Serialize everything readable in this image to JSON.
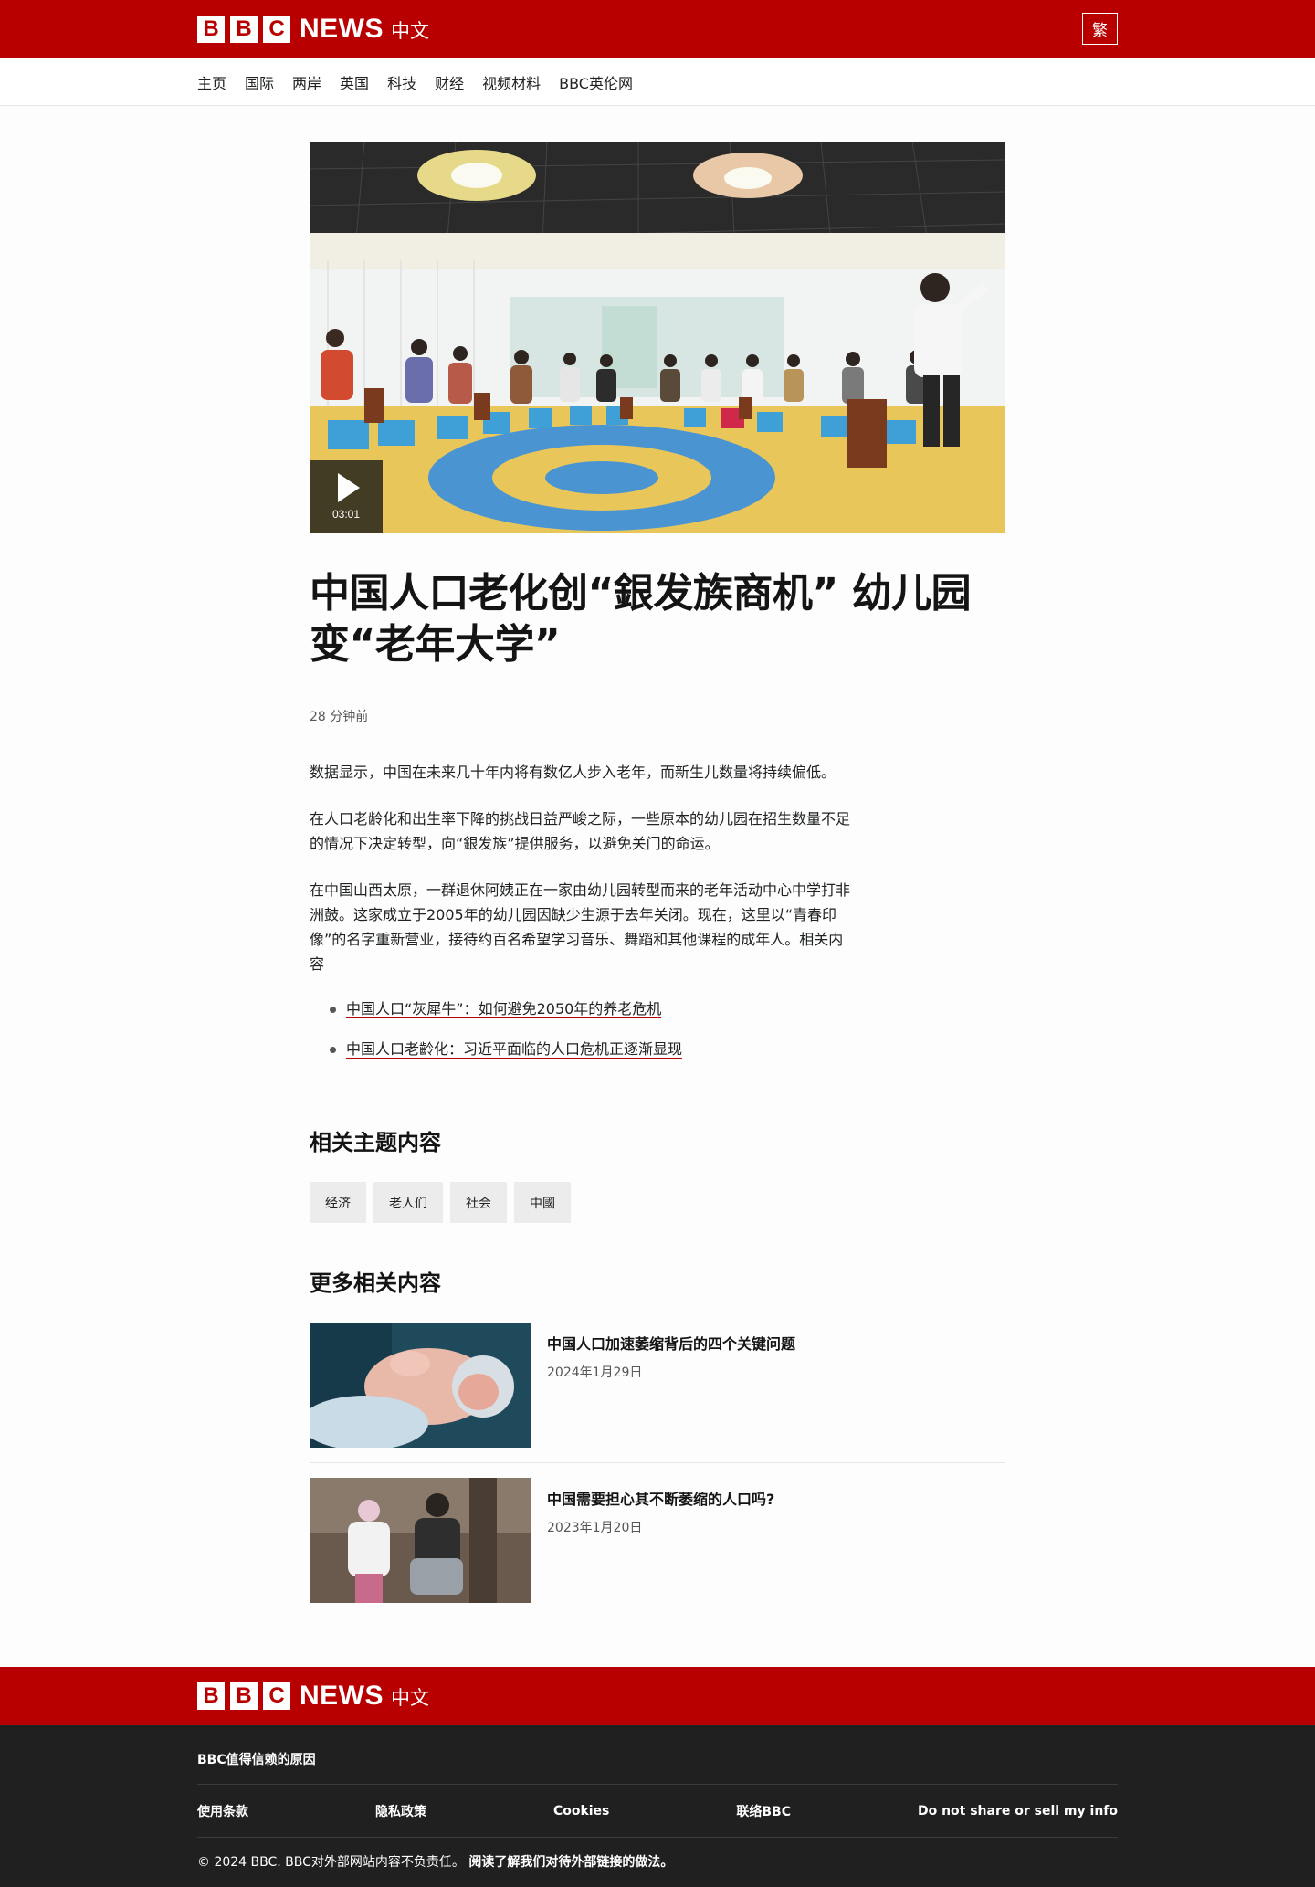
{
  "header": {
    "logo_letters": [
      "B",
      "B",
      "C"
    ],
    "logo_news": "NEWS",
    "logo_lang": "中文",
    "script_toggle": "繁"
  },
  "nav": {
    "items": [
      {
        "label": "主页"
      },
      {
        "label": "国际"
      },
      {
        "label": "两岸"
      },
      {
        "label": "英国"
      },
      {
        "label": "科技"
      },
      {
        "label": "财经"
      },
      {
        "label": "视频材料"
      },
      {
        "label": "BBC英伦网"
      }
    ]
  },
  "article": {
    "video_duration": "03:01",
    "headline": "中国人口老化创“銀发族商机” 幼儿园变“老年大学”",
    "timestamp": "28 分钟前",
    "paragraphs": [
      "数据显示，中国在未来几十年内将有数亿人步入老年，而新生儿数量将持续偏低。",
      "在人口老龄化和出生率下降的挑战日益严峻之际，一些原本的幼儿园在招生数量不足的情况下决定转型，向“銀发族”提供服务，以避免关门的命运。",
      "在中国山西太原，一群退休阿姨正在一家由幼儿园转型而来的老年活动中心中学打非洲鼓。这家成立于2005年的幼儿园因缺少生源于去年关闭。现在，这里以“青春印像”的名字重新营业，接待约百名希望学习音乐、舞蹈和其他课程的成年人。相关内容"
    ],
    "related_links": [
      {
        "label": "中国人口“灰犀牛”：如何避免2050年的养老危机"
      },
      {
        "label": "中国人口老齡化：习近平面临的人口危机正逐渐显现"
      }
    ]
  },
  "topics": {
    "title": "相关主题内容",
    "tags": [
      {
        "label": "经济"
      },
      {
        "label": "老人们"
      },
      {
        "label": "社会"
      },
      {
        "label": "中國"
      }
    ]
  },
  "more": {
    "title": "更多相关内容",
    "cards": [
      {
        "title": "中国人口加速萎缩背后的四个关键问题",
        "date": "2024年1月29日"
      },
      {
        "title": "中国需要担心其不断萎缩的人口吗?",
        "date": "2023年1月20日"
      }
    ]
  },
  "footer": {
    "trust_link": "BBC值得信赖的原因",
    "links": [
      {
        "label": "使用条款"
      },
      {
        "label": "隐私政策"
      },
      {
        "label": "Cookies"
      },
      {
        "label": "联络BBC"
      },
      {
        "label": "Do not share or sell my info"
      }
    ],
    "copyright": "© 2024 BBC. BBC对外部网站内容不负责任。",
    "external_link": "阅读了解我们对待外部链接的做法。"
  },
  "colors": {
    "brand_red": "#b80000",
    "footer_dark": "#202020",
    "tag_bg": "#ececec"
  }
}
